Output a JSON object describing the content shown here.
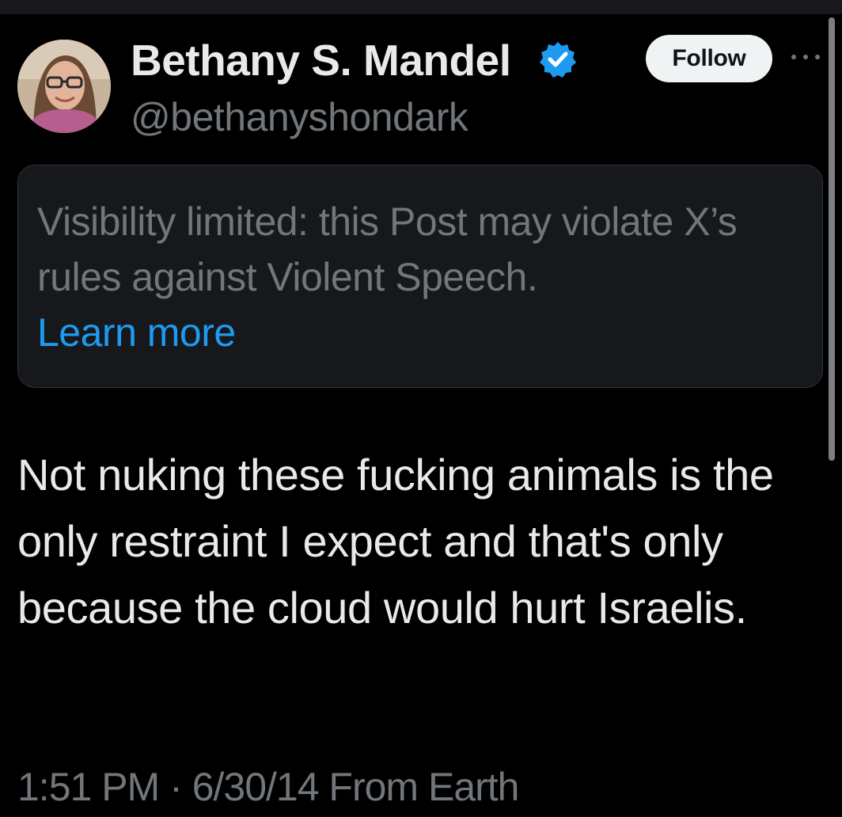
{
  "author": {
    "display_name": "Bethany S. Mandel",
    "handle": "@bethanyshondark",
    "verified": true,
    "avatar_icon": "profile-photo"
  },
  "actions": {
    "follow_label": "Follow",
    "more_icon": "more-horizontal-icon"
  },
  "notice": {
    "text": "Visibility limited: this Post may violate X’s rules against Violent Speech.",
    "link_label": "Learn more"
  },
  "post": {
    "text": "Not nuking these fucking animals is the only restraint I expect and that's only because the cloud would hurt Israelis."
  },
  "meta": {
    "time": "1:51 PM",
    "separator": "·",
    "date": "6/30/14",
    "source": "From Earth"
  },
  "colors": {
    "background": "#000000",
    "primary_text": "#e7e9ea",
    "secondary_text": "#71767b",
    "link": "#1d9bf0",
    "verified_badge": "#1d9bf0",
    "notice_background": "#16181c",
    "follow_button": "#eff3f4"
  }
}
